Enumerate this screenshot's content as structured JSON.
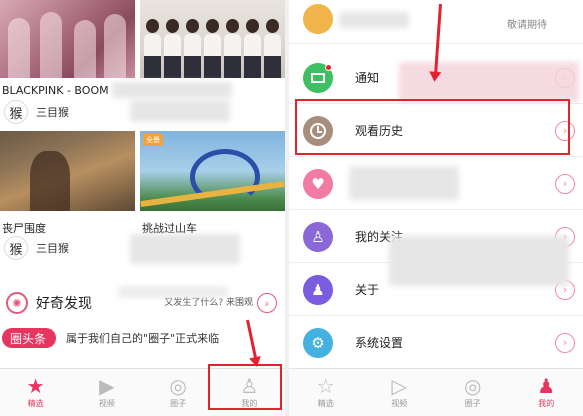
{
  "left": {
    "videos": [
      {
        "title": "BLACKPINK - BOOM",
        "author": "三目猴",
        "tag": ""
      },
      {
        "title": "",
        "author": "",
        "tag": ""
      },
      {
        "title": "丧尸围度",
        "author": "三目猴",
        "tag": ""
      },
      {
        "title": "挑战过山车",
        "author": "",
        "tag": "全景"
      }
    ],
    "section": {
      "title": "好奇发现",
      "hint": "又发生了什么? 来围观",
      "chevron": "›"
    },
    "news": {
      "tag": "圈头条",
      "text": "属于我们自己的\"圈子\"正式来临"
    },
    "tabs": [
      {
        "label": "精选",
        "icon": "star-icon",
        "glyph": "★"
      },
      {
        "label": "视频",
        "icon": "video-icon",
        "glyph": "▶"
      },
      {
        "label": "圈子",
        "icon": "circles-icon",
        "glyph": "◎"
      },
      {
        "label": "我的",
        "icon": "person-icon",
        "glyph": "♙"
      }
    ]
  },
  "right": {
    "top": {
      "coming": "敬请期待"
    },
    "menu": [
      {
        "label": "通知",
        "color": "#3fbf63",
        "icon": "envelope-icon",
        "badge": true
      },
      {
        "label": "观看历史",
        "color": "#a98d7c",
        "icon": "clock-icon",
        "badge": false
      },
      {
        "label": "",
        "color": "#f27ba2",
        "icon": "heart-icon",
        "badge": false
      },
      {
        "label": "我的关注",
        "color": "#8b68d8",
        "icon": "follow-user-icon",
        "badge": false
      },
      {
        "label": "关于",
        "color": "#7a5ce0",
        "icon": "user-icon",
        "badge": false
      },
      {
        "label": "系统设置",
        "color": "#45b1e0",
        "icon": "gear-icon",
        "badge": false
      }
    ],
    "tabs": [
      {
        "label": "精选",
        "icon": "star-icon",
        "glyph": "☆"
      },
      {
        "label": "视频",
        "icon": "video-icon",
        "glyph": "▷"
      },
      {
        "label": "圈子",
        "icon": "circles-icon",
        "glyph": "◎"
      },
      {
        "label": "我的",
        "icon": "person-icon",
        "glyph": "♟"
      }
    ]
  },
  "colors": {
    "accent": "#e8355f",
    "annotation": "#e3222d"
  }
}
